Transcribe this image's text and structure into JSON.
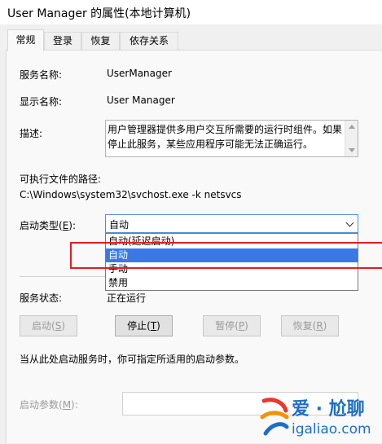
{
  "window": {
    "title": "User Manager 的属性(本地计算机)"
  },
  "tabs": [
    {
      "label": "常规",
      "active": true
    },
    {
      "label": "登录",
      "active": false
    },
    {
      "label": "恢复",
      "active": false
    },
    {
      "label": "依存关系",
      "active": false
    }
  ],
  "general": {
    "service_name_label": "服务名称:",
    "service_name": "UserManager",
    "display_name_label": "显示名称:",
    "display_name": "User Manager",
    "description_label": "描述:",
    "description": "用户管理器提供多用户交互所需要的运行时组件。如果停止此服务，某些应用程序可能无法正确运行。",
    "exe_path_label": "可执行文件的路径:",
    "exe_path": "C:\\Windows\\system32\\svchost.exe -k netsvcs",
    "startup_type_label": "启动类型(",
    "startup_type_key": "E",
    "startup_type_label_end": "):",
    "startup_type_value": "自动",
    "startup_options": [
      "自动(延迟启动)",
      "自动",
      "手动",
      "禁用"
    ],
    "startup_selected_index": 1,
    "service_status_label": "服务状态:",
    "service_status": "正在运行",
    "buttons": {
      "start": {
        "text": "启动(",
        "key": "S",
        "end": ")"
      },
      "stop": {
        "text": "停止(",
        "key": "T",
        "end": ")"
      },
      "pause": {
        "text": "暂停(",
        "key": "P",
        "end": ")"
      },
      "resume": {
        "text": "恢复(",
        "key": "R",
        "end": ")"
      }
    },
    "hint": "当从此处启动服务时，你可指定所适用的启动参数。",
    "start_params_label": "启动参数(",
    "start_params_key": "M",
    "start_params_label_end": "):",
    "start_params_value": ""
  },
  "watermark": {
    "line1": "爱 · 尬聊",
    "line2": "igaliao.com"
  },
  "colors": {
    "selection": "#3b78e7",
    "highlight_box": "#e51d1d",
    "focus_border": "#4f8ed6"
  }
}
